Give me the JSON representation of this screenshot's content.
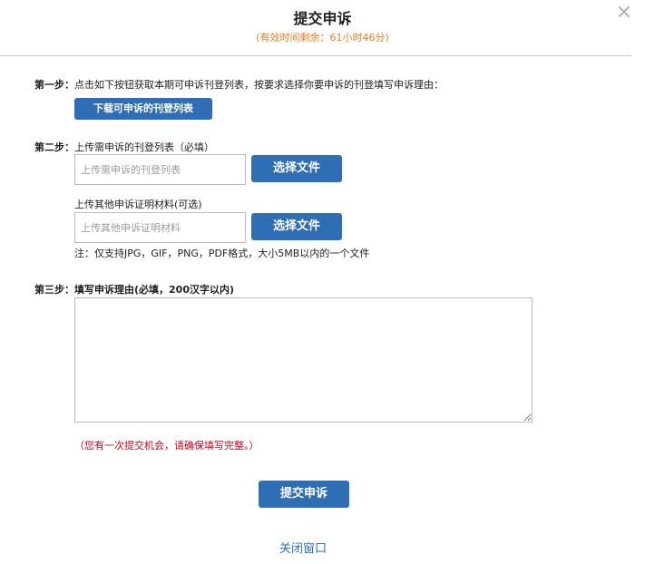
{
  "dialog": {
    "title": "提交申诉",
    "subtitle": "(有效时间剩余：61小时46分)",
    "close_symbol": "✕"
  },
  "step1": {
    "label": "第一步：",
    "text": "点击如下按钮获取本期可申诉刊登列表，按要求选择你要申诉的刊登填写申诉理由：",
    "download_button": "下载可申诉的刊登列表"
  },
  "step2": {
    "label": "第二步：",
    "upload1_text": "上传需申诉的刊登列表（必填）",
    "upload1_placeholder": "上传需申诉的刊登列表",
    "upload1_button": "选择文件",
    "upload2_text": "上传其他申诉证明材料(可选)",
    "upload2_placeholder": "上传其他申诉证明材料",
    "upload2_button": "选择文件",
    "note": "注：仅支持JPG，GIF，PNG，PDF格式，大小5MB以内的一个文件"
  },
  "step3": {
    "label": "第三步：",
    "text": "填写申诉理由(必填，200汉字以内)",
    "reason_value": "",
    "warning": "（您有一次提交机会，请确保填写完整。）"
  },
  "footer": {
    "submit_button": "提交申诉",
    "close_link": "关闭窗口"
  },
  "colors": {
    "primary": "#2f6eb5",
    "accent": "#e67e22",
    "warning": "#d0021b"
  }
}
